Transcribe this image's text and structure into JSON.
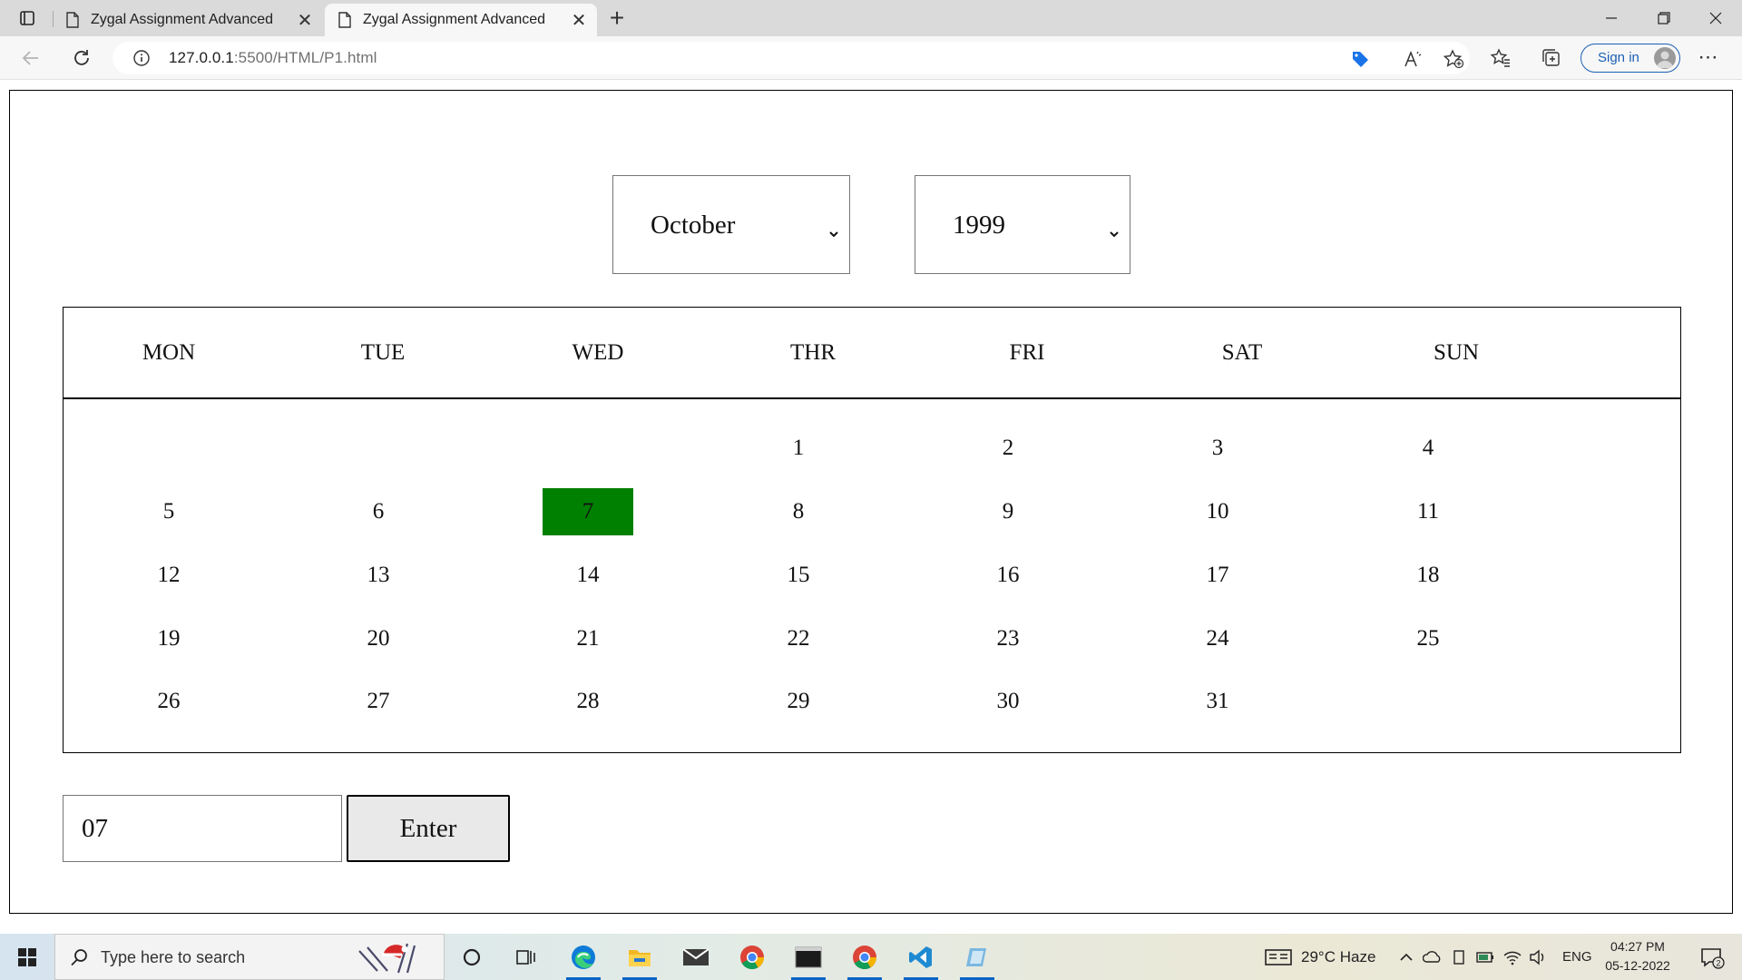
{
  "browser": {
    "tabs": [
      {
        "title": "Zygal Assignment Advanced",
        "active": false
      },
      {
        "title": "Zygal Assignment Advanced",
        "active": true
      }
    ],
    "url_host": "127.0.0.1",
    "url_path": ":5500/HTML/P1.html",
    "signin_label": "Sign in",
    "icons": [
      "tab-actions-icon",
      "page-icon",
      "close-icon",
      "plus-icon",
      "back-icon",
      "refresh-icon",
      "info-icon",
      "shopping-tag-icon",
      "read-aloud-icon",
      "add-favorite-icon",
      "favorites-icon",
      "collections-icon",
      "avatar-icon",
      "more-icon",
      "minimize-icon",
      "restore-icon",
      "close-window-icon"
    ]
  },
  "calendar": {
    "month": "October",
    "year": "1999",
    "day_names": [
      "MON",
      "TUE",
      "WED",
      "THR",
      "FRI",
      "SAT",
      "SUN"
    ],
    "weeks": [
      [
        "",
        "",
        "",
        "1",
        "2",
        "3",
        "4"
      ],
      [
        "5",
        "6",
        "7",
        "8",
        "9",
        "10",
        "11"
      ],
      [
        "12",
        "13",
        "14",
        "15",
        "16",
        "17",
        "18"
      ],
      [
        "19",
        "20",
        "21",
        "22",
        "23",
        "24",
        "25"
      ],
      [
        "26",
        "27",
        "28",
        "29",
        "30",
        "31",
        ""
      ]
    ],
    "selected_day": "7",
    "highlight_color": "#008000"
  },
  "entry": {
    "value": "07",
    "button_label": "Enter"
  },
  "taskbar": {
    "search_placeholder": "Type here to search",
    "weather": "29°C  Haze",
    "language": "ENG",
    "time": "04:27 PM",
    "date": "05-12-2022",
    "notification_count": "2",
    "apps": [
      "windows-start-icon",
      "task-view-icon",
      "widgets-icon",
      "edge-icon",
      "file-explorer-icon",
      "mail-icon",
      "chrome-icon",
      "terminal-icon",
      "chrome-icon",
      "vscode-icon",
      "app-icon"
    ]
  }
}
